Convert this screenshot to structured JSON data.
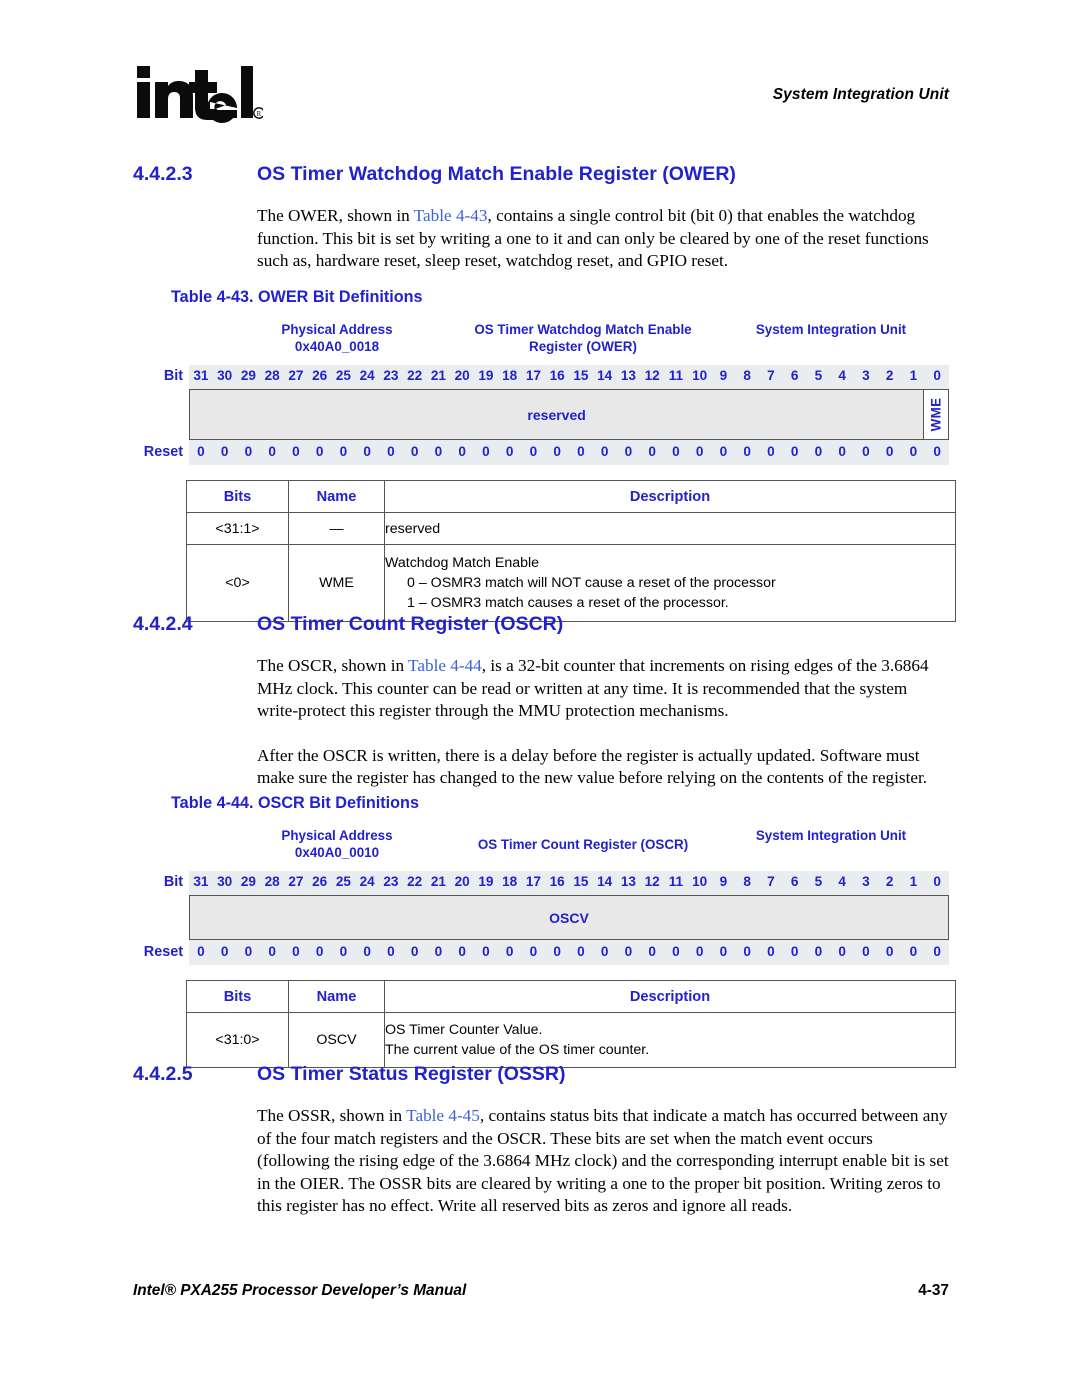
{
  "header": {
    "logo_text": "intel",
    "logo_mark": "®",
    "chapter_title": "System Integration Unit"
  },
  "sections": [
    {
      "number": "4.4.2.3",
      "title": "OS Timer Watchdog Match Enable Register (OWER)",
      "paragraphs": [
        "The OWER, shown in Table 4-43, contains a single control bit (bit 0) that enables the watchdog function. This bit is set by writing a one to it and can only be cleared by one of the reset functions such as, hardware reset, sleep reset, watchdog reset, and GPIO reset."
      ],
      "paragraph_prefix": "The OWER, shown in ",
      "paragraph_link": "Table 4-43",
      "paragraph_suffix": ", contains a single control bit (bit 0) that enables the watchdog function. This bit is set by writing a one to it and can only be cleared by one of the reset functions such as, hardware reset, sleep reset, watchdog reset, and GPIO reset."
    }
  ],
  "table_43": {
    "caption": "Table 4-43. OWER Bit Definitions",
    "physical_address_label": "Physical Address",
    "physical_address_value": "0x40A0_0018",
    "register_name_line1": "OS Timer Watchdog Match Enable",
    "register_name_line2": "Register (OWER)",
    "unit_label": "System Integration Unit",
    "bit_label": "Bit",
    "reset_label": "Reset",
    "bit_numbers": [
      "31",
      "30",
      "29",
      "28",
      "27",
      "26",
      "25",
      "24",
      "23",
      "22",
      "21",
      "20",
      "19",
      "18",
      "17",
      "16",
      "15",
      "14",
      "13",
      "12",
      "11",
      "10",
      "9",
      "8",
      "7",
      "6",
      "5",
      "4",
      "3",
      "2",
      "1",
      "0"
    ],
    "reset_values": [
      "0",
      "0",
      "0",
      "0",
      "0",
      "0",
      "0",
      "0",
      "0",
      "0",
      "0",
      "0",
      "0",
      "0",
      "0",
      "0",
      "0",
      "0",
      "0",
      "0",
      "0",
      "0",
      "0",
      "0",
      "0",
      "0",
      "0",
      "0",
      "0",
      "0",
      "0",
      "0"
    ],
    "fields": [
      {
        "name": "reserved",
        "span_bits": 31,
        "orientation": "horizontal"
      },
      {
        "name": "WME",
        "span_bits": 1,
        "orientation": "vertical"
      }
    ],
    "columns": [
      "Bits",
      "Name",
      "Description"
    ],
    "rows": [
      {
        "bits": "<31:1>",
        "name": "—",
        "description_lines": [
          "reserved"
        ],
        "sub_lines": []
      },
      {
        "bits": "<0>",
        "name": "WME",
        "description_lines": [
          "Watchdog Match Enable"
        ],
        "sub_lines": [
          "0 –  OSMR3 match will NOT cause a reset of the processor",
          "1 –  OSMR3 match causes a reset of the processor."
        ]
      }
    ]
  },
  "section_4424": {
    "number": "4.4.2.4",
    "title": "OS Timer Count Register (OSCR)",
    "p1_prefix": "The OSCR, shown in ",
    "p1_link": "Table 4-44",
    "p1_suffix": ", is a 32-bit counter that increments on rising edges of the 3.6864 MHz clock. This counter can be read or written at any time. It is recommended that the system write-protect this register through the MMU protection mechanisms.",
    "p2": "After the OSCR is written, there is a delay before the register is actually updated. Software must make sure the register has changed to the new value before relying on the contents of the register."
  },
  "table_44": {
    "caption": "Table 4-44. OSCR Bit Definitions",
    "physical_address_label": "Physical Address",
    "physical_address_value": "0x40A0_0010",
    "register_name_line1": "OS Timer Count Register (OSCR)",
    "register_name_line2": "",
    "unit_label": "System Integration Unit",
    "bit_label": "Bit",
    "reset_label": "Reset",
    "bit_numbers": [
      "31",
      "30",
      "29",
      "28",
      "27",
      "26",
      "25",
      "24",
      "23",
      "22",
      "21",
      "20",
      "19",
      "18",
      "17",
      "16",
      "15",
      "14",
      "13",
      "12",
      "11",
      "10",
      "9",
      "8",
      "7",
      "6",
      "5",
      "4",
      "3",
      "2",
      "1",
      "0"
    ],
    "reset_values": [
      "0",
      "0",
      "0",
      "0",
      "0",
      "0",
      "0",
      "0",
      "0",
      "0",
      "0",
      "0",
      "0",
      "0",
      "0",
      "0",
      "0",
      "0",
      "0",
      "0",
      "0",
      "0",
      "0",
      "0",
      "0",
      "0",
      "0",
      "0",
      "0",
      "0",
      "0",
      "0"
    ],
    "fields": [
      {
        "name": "OSCV",
        "span_bits": 32,
        "orientation": "horizontal"
      }
    ],
    "columns": [
      "Bits",
      "Name",
      "Description"
    ],
    "rows": [
      {
        "bits": "<31:0>",
        "name": "OSCV",
        "description_lines": [
          "OS Timer Counter Value.",
          "The current value of the OS timer counter."
        ],
        "sub_lines": []
      }
    ]
  },
  "section_4425": {
    "number": "4.4.2.5",
    "title": "OS Timer Status Register (OSSR)",
    "p1_prefix": "The OSSR, shown in ",
    "p1_link": "Table 4-45",
    "p1_suffix": ", contains status bits that indicate a match has occurred between any of the four match registers and the OSCR. These bits are set when the match event occurs (following the rising edge of the 3.6864 MHz clock) and the corresponding interrupt enable bit is set in the OIER. The OSSR bits are cleared by writing a one to the proper bit position. Writing zeros to this register has no effect. Write all reserved bits as zeros and ignore all reads."
  },
  "footer": {
    "document_title": "Intel® PXA255 Processor Developer’s Manual",
    "page_number": "4-37"
  },
  "colors": {
    "heading_blue": "#2222cc",
    "link_blue": "#3a63d8",
    "field_fill": "#e8e8e8",
    "strip_fill": "#e9edf0",
    "border_gray": "#555555"
  }
}
